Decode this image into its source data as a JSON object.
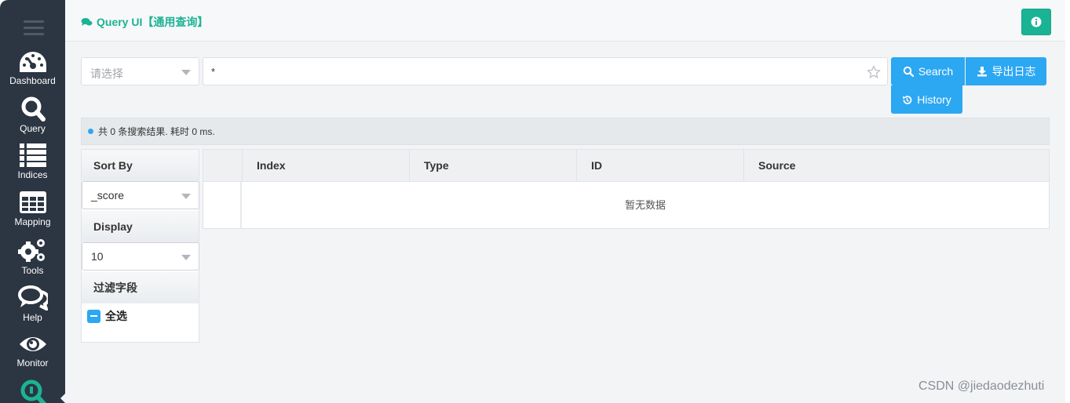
{
  "sidebar": {
    "items": [
      {
        "label": "Dashboard",
        "icon": "dashboard-icon"
      },
      {
        "label": "Query",
        "icon": "search-icon"
      },
      {
        "label": "Indices",
        "icon": "list-icon"
      },
      {
        "label": "Mapping",
        "icon": "table-icon"
      },
      {
        "label": "Tools",
        "icon": "gears-icon"
      },
      {
        "label": "Help",
        "icon": "comments-icon"
      },
      {
        "label": "Monitor",
        "icon": "eye-icon"
      }
    ]
  },
  "header": {
    "title": "Query UI【通用查询】",
    "accent_color": "#1ab394"
  },
  "search": {
    "index_placeholder": "请选择",
    "query_value": "*",
    "search_label": "Search",
    "export_label": "导出日志",
    "history_label": "History",
    "button_color": "#2ca7f2"
  },
  "result": {
    "summary": "共 0 条搜索结果. 耗时 0 ms."
  },
  "panel": {
    "sort_by_label": "Sort By",
    "sort_by_value": "_score",
    "display_label": "Display",
    "display_value": "10",
    "filter_label": "过滤字段",
    "select_all_label": "全选"
  },
  "table": {
    "columns": [
      "Index",
      "Type",
      "ID",
      "Source"
    ],
    "empty_text": "暂无数据"
  },
  "watermark": "CSDN @jiedaodezhuti"
}
